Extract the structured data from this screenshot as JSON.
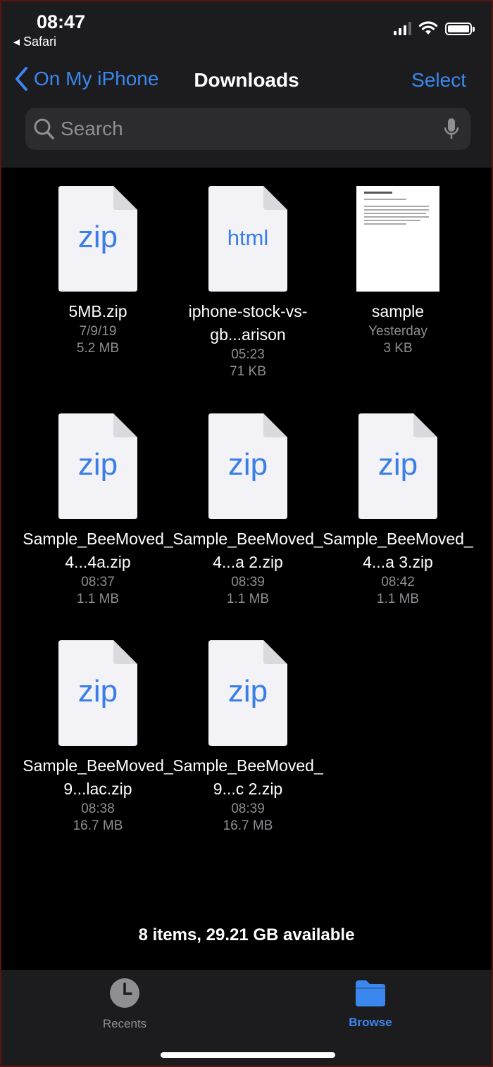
{
  "status": {
    "time": "08:47",
    "back_app": "◂ Safari"
  },
  "nav": {
    "back_label": "On My iPhone",
    "title": "Downloads",
    "select_label": "Select"
  },
  "search": {
    "placeholder": "Search"
  },
  "files": [
    {
      "type": "zip",
      "label": "zip",
      "name": "5MB.zip",
      "date": "7/9/19",
      "size": "5.2 MB"
    },
    {
      "type": "html",
      "label": "html",
      "name": "iphone-stock-vs-gb...arison",
      "date": "05:23",
      "size": "71 KB"
    },
    {
      "type": "pdf",
      "label": "",
      "name": "sample",
      "date": "Yesterday",
      "size": "3 KB"
    },
    {
      "type": "zip",
      "label": "zip",
      "name": "Sample_BeeMoved_4...4a.zip",
      "date": "08:37",
      "size": "1.1 MB"
    },
    {
      "type": "zip",
      "label": "zip",
      "name": "Sample_BeeMoved_4...a 2.zip",
      "date": "08:39",
      "size": "1.1 MB"
    },
    {
      "type": "zip",
      "label": "zip",
      "name": "Sample_BeeMoved_4...a 3.zip",
      "date": "08:42",
      "size": "1.1 MB"
    },
    {
      "type": "zip",
      "label": "zip",
      "name": "Sample_BeeMoved_9...lac.zip",
      "date": "08:38",
      "size": "16.7 MB"
    },
    {
      "type": "zip",
      "label": "zip",
      "name": "Sample_BeeMoved_9...c 2.zip",
      "date": "08:39",
      "size": "16.7 MB"
    }
  ],
  "footer": {
    "summary": "8 items, 29.21 GB available"
  },
  "tabs": {
    "recents_label": "Recents",
    "browse_label": "Browse"
  },
  "colors": {
    "accent": "#3b87f0",
    "header_bg": "#1c1c1e",
    "secondary_text": "#8e8e93"
  },
  "icons": [
    "chevron-left-icon",
    "search-icon",
    "microphone-icon",
    "clock-icon",
    "folder-icon",
    "wifi-icon",
    "battery-icon",
    "signal-icon"
  ]
}
